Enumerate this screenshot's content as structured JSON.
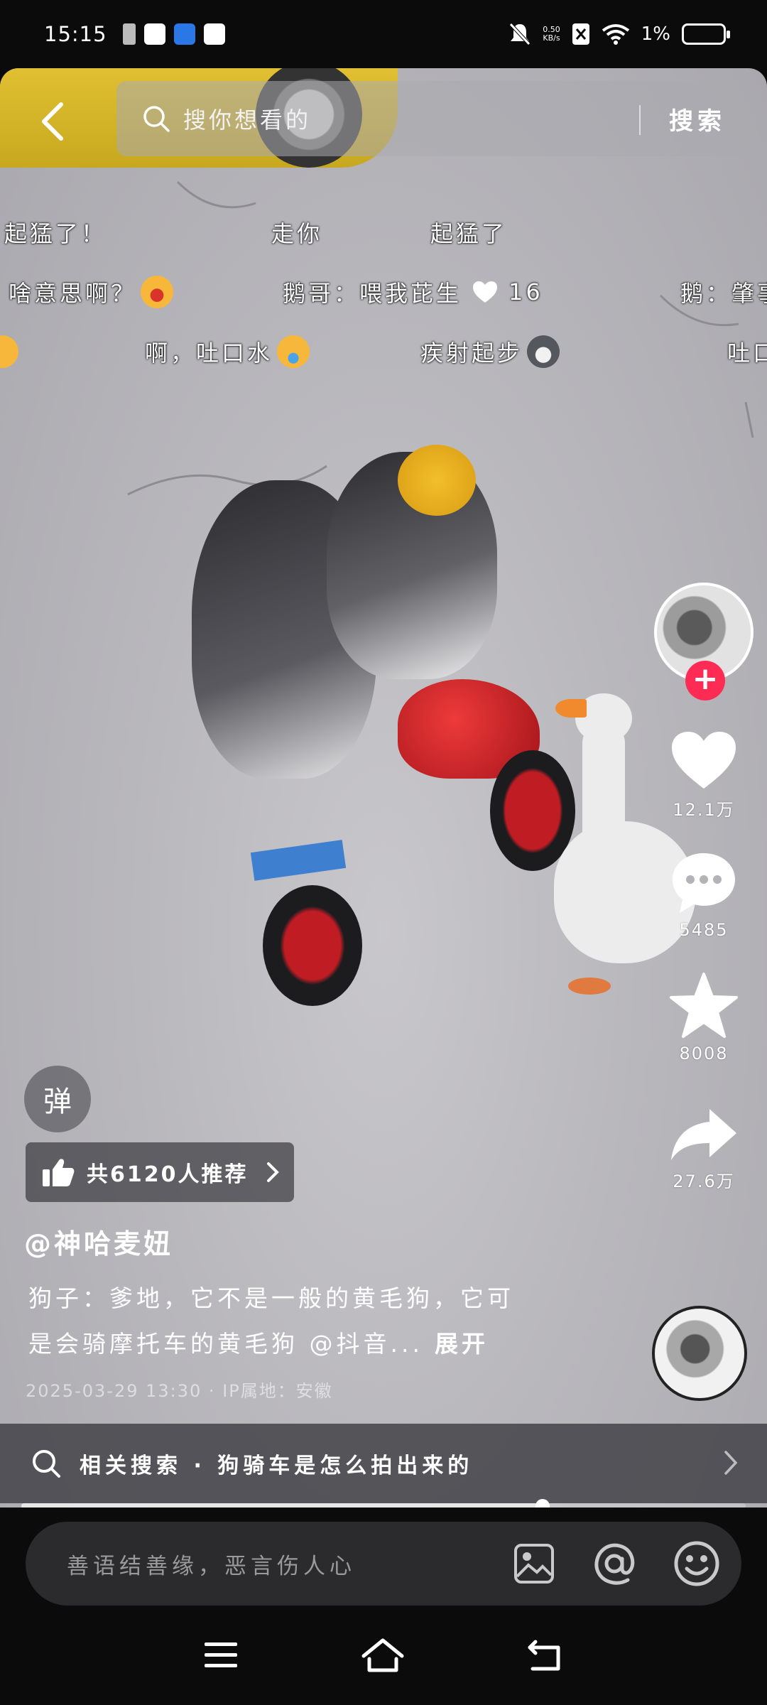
{
  "status_bar": {
    "time": "15:15",
    "net_speed_value": "0.50",
    "net_speed_unit": "KB/s",
    "battery_percent": "1%"
  },
  "search": {
    "placeholder": "搜你想看的",
    "button_label": "搜索"
  },
  "danmaku": [
    {
      "text": "起猛了！"
    },
    {
      "text": "走你"
    },
    {
      "text": "起猛了"
    },
    {
      "text": "啥意思啊？"
    },
    {
      "text": "鹅哥：喂我芘生"
    },
    {
      "text": "16"
    },
    {
      "text": "鹅：肇事"
    },
    {
      "text": "啊，吐口水"
    },
    {
      "text": "疾射起步"
    },
    {
      "text": "吐口"
    }
  ],
  "rail": {
    "likes": "12.1万",
    "comments": "5485",
    "favorites": "8008",
    "shares": "27.6万",
    "follow_symbol": "+"
  },
  "danmu_toggle_label": "弹",
  "recommend_text": "共6120人推荐",
  "author": "@神哈麦妞",
  "description": "狗子：爹地，它不是一般的黄毛狗，它可是会骑摩托车的黄毛狗 @抖音...",
  "description_line1": "狗子：爹地，它不是一般的黄毛狗，它可",
  "description_line2": "是会骑摩托车的黄毛狗 @抖音...",
  "expand_label": "展开",
  "post_meta": "2025-03-29 13:30 · IP属地：安徽",
  "related_search": "相关搜索 · 狗骑车是怎么拍出来的",
  "progress_fraction": 0.72,
  "comment_placeholder": "善语结善缘，恶言伤人心",
  "colors": {
    "accent_red": "#fe2c55",
    "background": "#0b0b0b"
  },
  "icons": [
    "back-icon",
    "search-icon",
    "heart-icon",
    "comment-icon",
    "star-icon",
    "share-icon",
    "thumb-up-icon",
    "image-icon",
    "at-icon",
    "emoji-icon",
    "menu-icon",
    "home-icon",
    "back-nav-icon"
  ]
}
